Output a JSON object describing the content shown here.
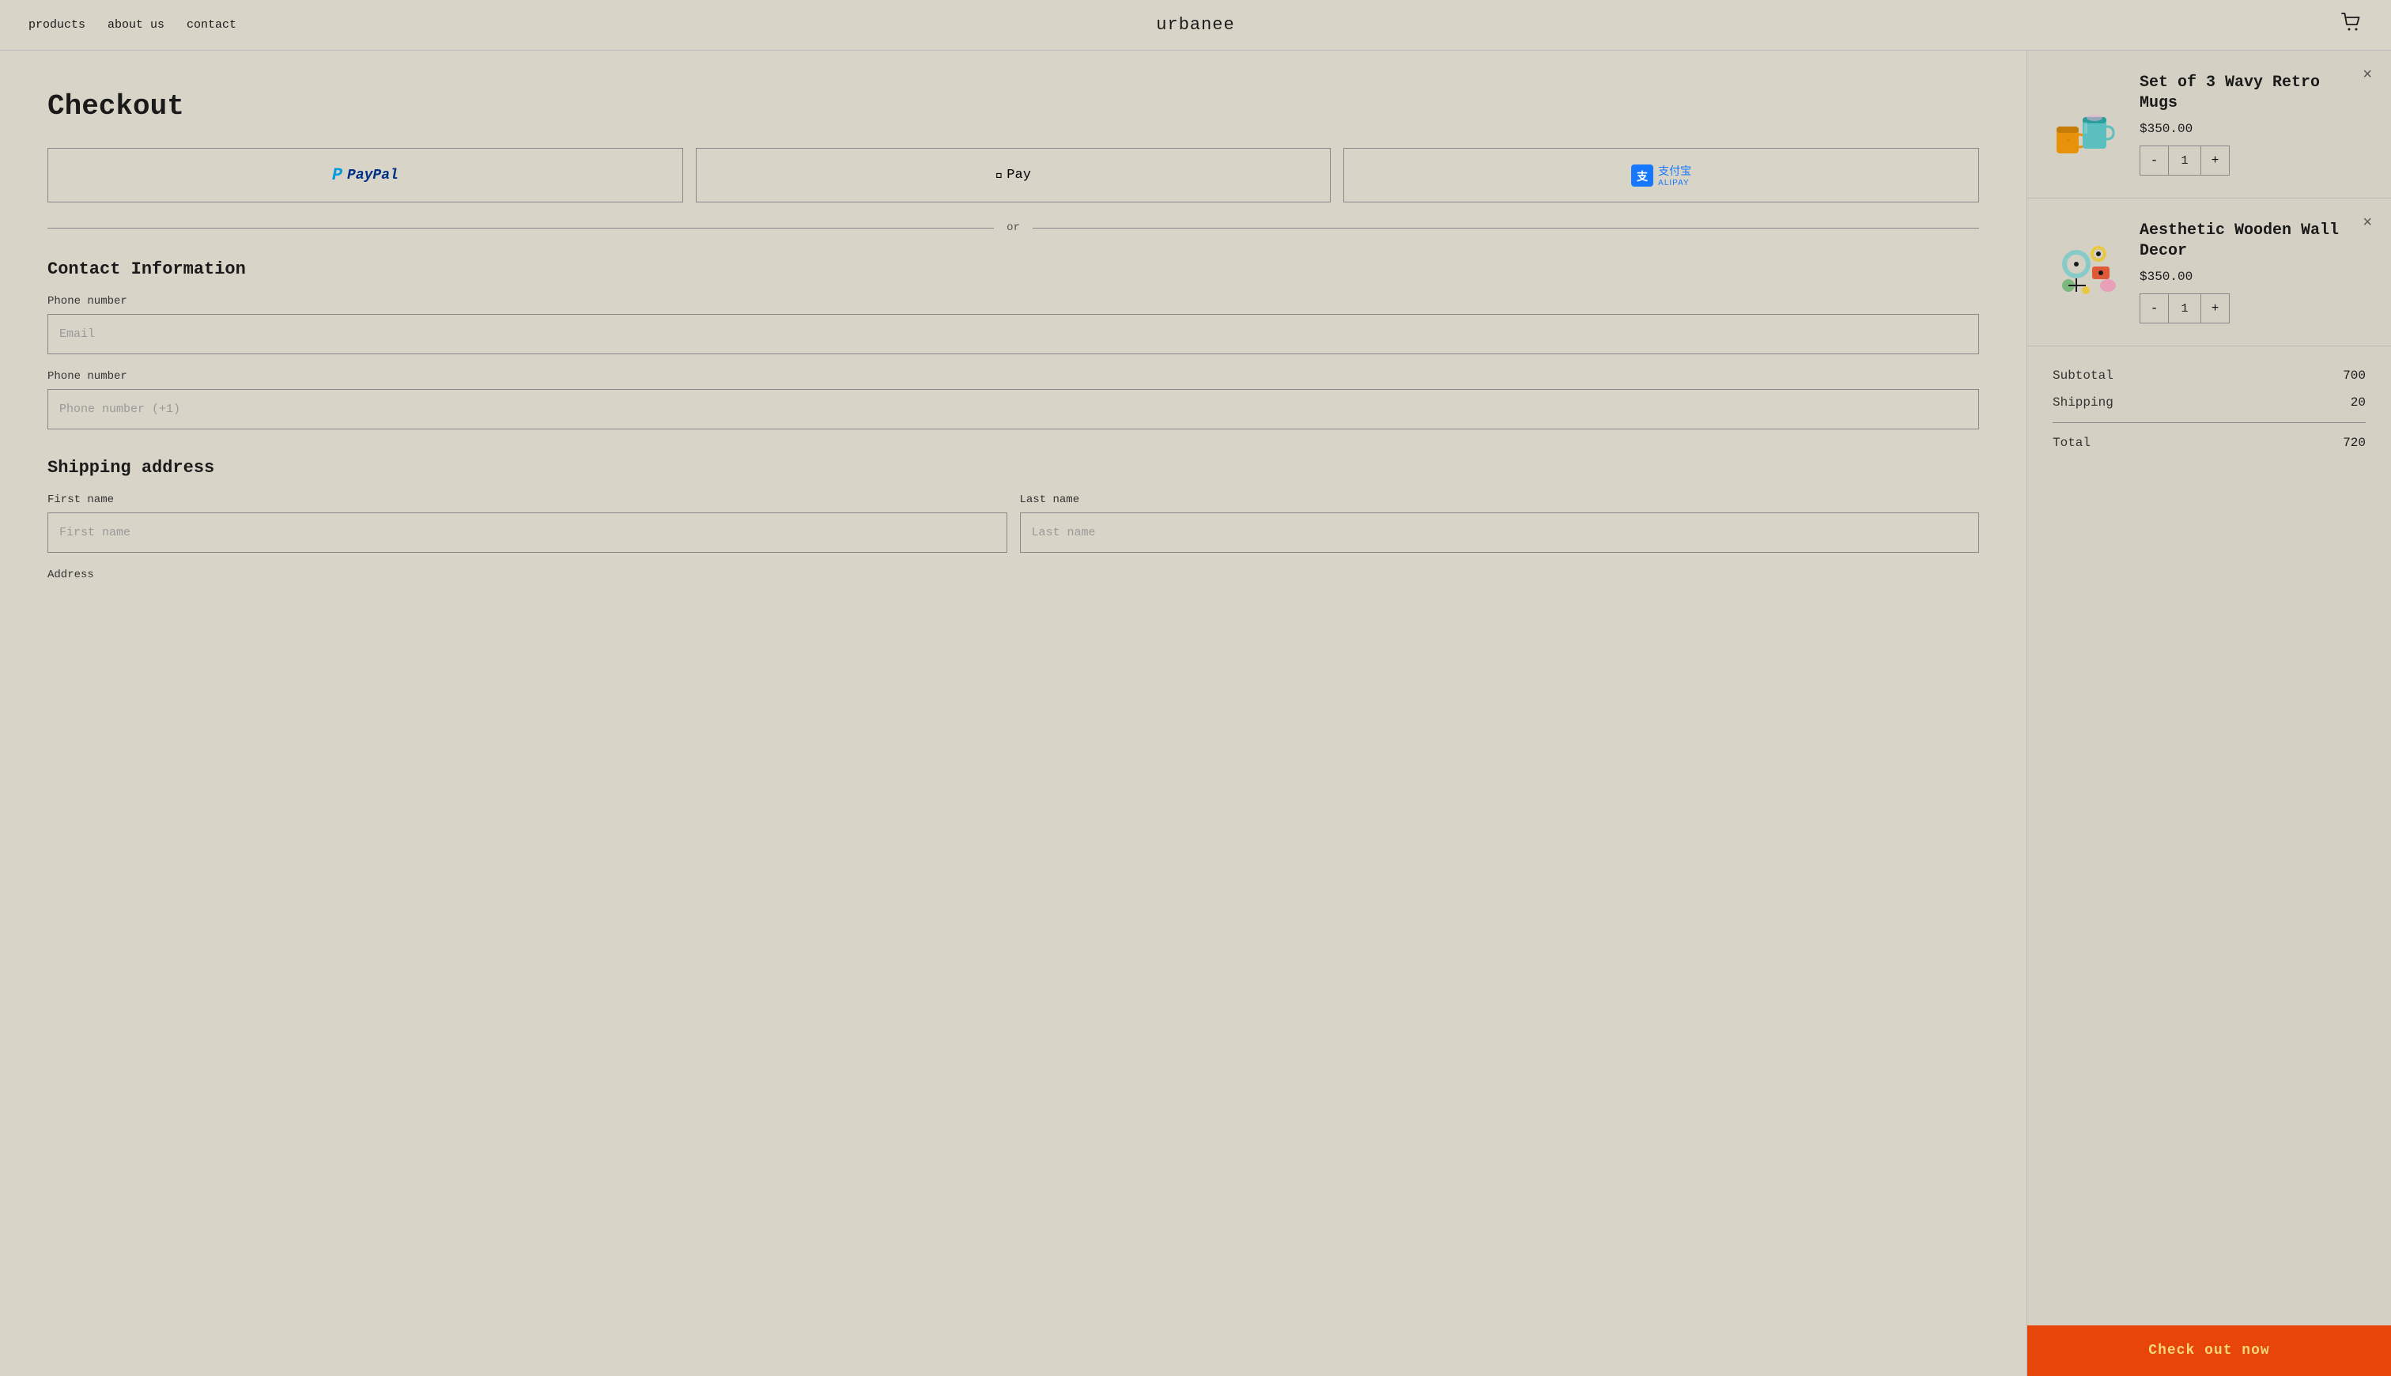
{
  "header": {
    "nav": [
      {
        "label": "products",
        "href": "#"
      },
      {
        "label": "about us",
        "href": "#"
      },
      {
        "label": "contact",
        "href": "#"
      }
    ],
    "logo": "urbanee",
    "cart_icon": "🛒"
  },
  "checkout": {
    "title": "Checkout",
    "payment_buttons": [
      {
        "id": "paypal",
        "label": "PayPal"
      },
      {
        "id": "applepay",
        "label": "Apple Pay"
      },
      {
        "id": "alipay",
        "label": "Alipay"
      }
    ],
    "divider_text": "or",
    "contact_section": {
      "title": "Contact Information",
      "email_label": "Phone number",
      "email_placeholder": "Email",
      "phone_label": "Phone number",
      "phone_placeholder": "Phone number (+1)"
    },
    "shipping_section": {
      "title": "Shipping address",
      "first_name_label": "First name",
      "first_name_placeholder": "First name",
      "last_name_label": "Last name",
      "last_name_placeholder": "Last name",
      "address_label": "Address"
    }
  },
  "order_summary": {
    "products": [
      {
        "id": "product-1",
        "name": "Set of 3 Wavy Retro Mugs",
        "price": "$350.00",
        "quantity": 1
      },
      {
        "id": "product-2",
        "name": "Aesthetic Wooden Wall Decor",
        "price": "$350.00",
        "quantity": 1
      }
    ],
    "subtotal_label": "Subtotal",
    "subtotal_value": "700",
    "shipping_label": "Shipping",
    "shipping_value": "20",
    "total_label": "Total",
    "total_value": "720",
    "checkout_button_label": "Check out now"
  }
}
